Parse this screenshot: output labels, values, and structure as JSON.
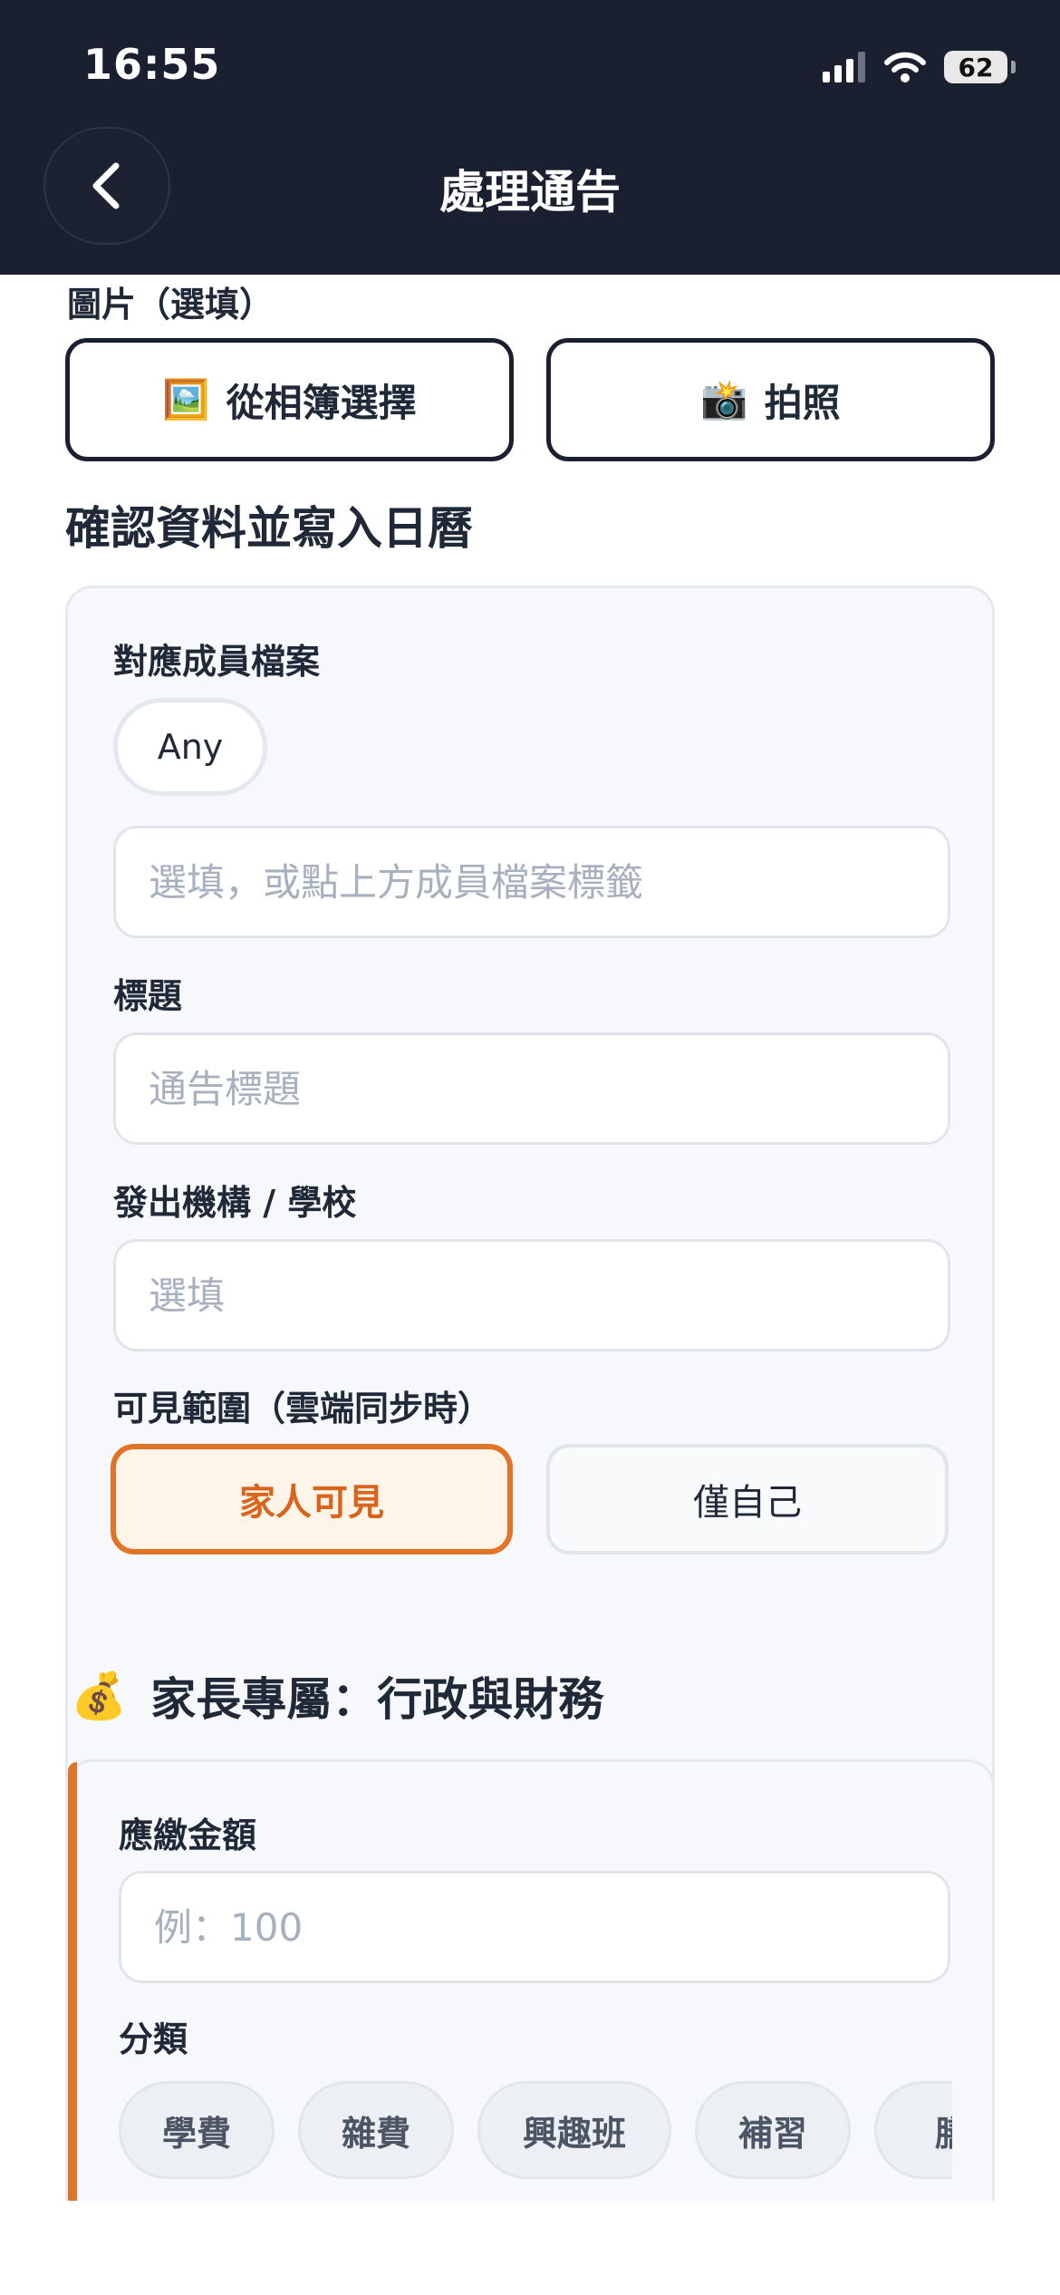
{
  "status_bar": {
    "time": "16:55",
    "battery": "62"
  },
  "header": {
    "title": "處理通告"
  },
  "image_section": {
    "label": "圖片（選填）",
    "album_button": {
      "icon": "🖼️",
      "label": "從相簿選擇"
    },
    "camera_button": {
      "icon": "📸",
      "label": "拍照"
    }
  },
  "confirm_section": {
    "title": "確認資料並寫入日曆",
    "member_label": "對應成員檔案",
    "member_chip": "Any",
    "member_input_placeholder": "選填，或點上方成員檔案標籤",
    "title_label": "標題",
    "title_placeholder": "通告標題",
    "org_label": "發出機構 / 學校",
    "org_placeholder": "選填",
    "visibility_label": "可見範圍（雲端同步時）",
    "visibility_options": [
      "家人可見",
      "僅自己"
    ]
  },
  "parent_section": {
    "icon": "💰",
    "title": "家長專屬：行政與財務",
    "amount_label": "應繳金額",
    "amount_placeholder": "例：100",
    "category_label": "分類",
    "categories": [
      "學費",
      "雜費",
      "興趣班",
      "補習",
      "膳"
    ]
  }
}
